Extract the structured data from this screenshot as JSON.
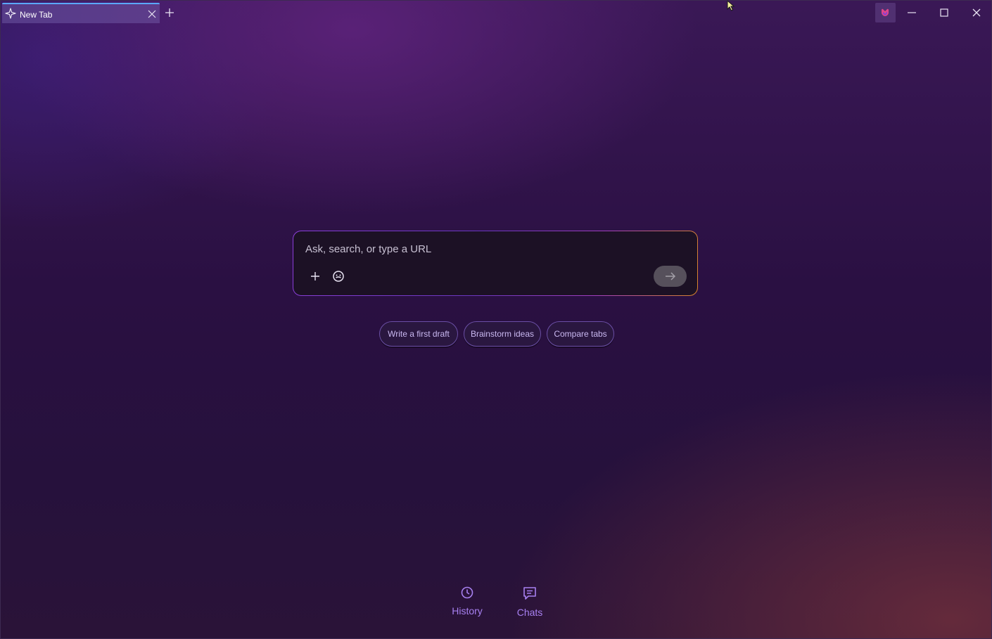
{
  "tab": {
    "title": "New Tab"
  },
  "omnibox": {
    "placeholder": "Ask, search, or type a URL"
  },
  "suggestions": [
    {
      "label": "Write a first draft"
    },
    {
      "label": "Brainstorm ideas"
    },
    {
      "label": "Compare tabs"
    }
  ],
  "bottom_nav": {
    "history_label": "History",
    "chats_label": "Chats"
  },
  "colors": {
    "accent": "#a780f0",
    "omnibox_bg": "#1c1125",
    "tab_indicator": "#5aa8ff"
  },
  "icons": {
    "tab": "sparkle-icon",
    "tab_close": "close-icon",
    "new_tab": "plus-icon",
    "extension": "copilot-icon",
    "minimize": "minimize-icon",
    "maximize": "maximize-icon",
    "close": "close-icon",
    "attach": "plus-icon",
    "persona": "smiley-icon",
    "send": "arrow-right-icon",
    "history": "clock-icon",
    "chats": "chat-bubble-icon"
  }
}
